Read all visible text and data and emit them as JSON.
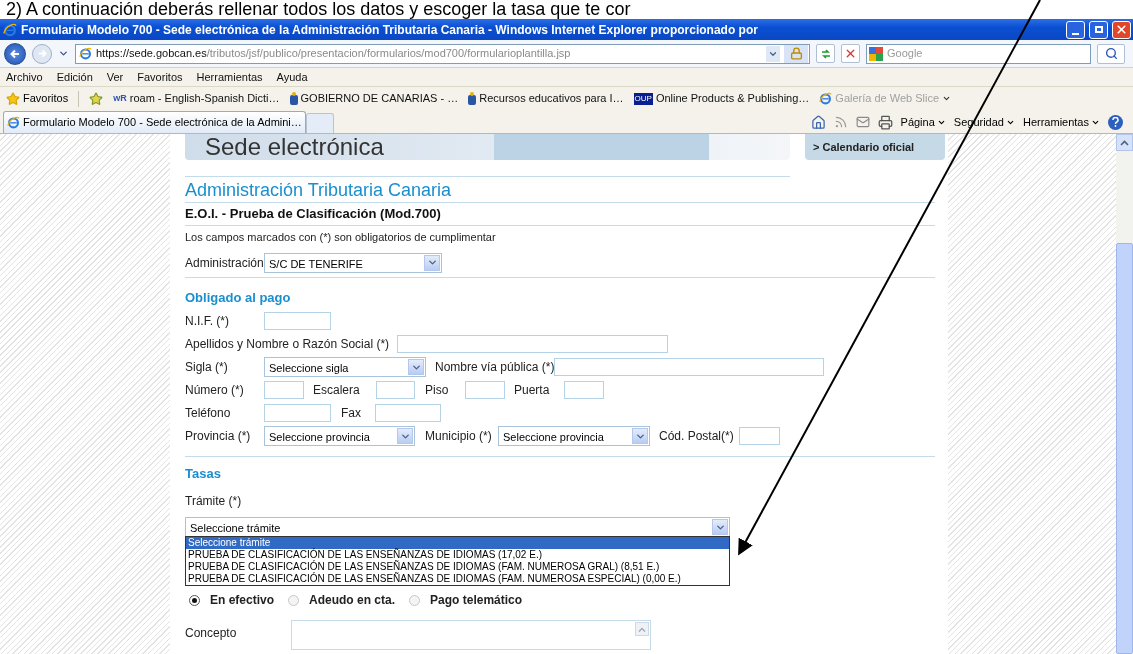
{
  "annotation": {
    "text": "2) A continuación deberás rellenar todos los datos y escoger la tasa que te cor"
  },
  "window": {
    "title": "Formulario Modelo 700 - Sede electrónica de la Administración Tributaria Canaria - Windows Internet Explorer proporcionado por"
  },
  "address_bar": {
    "url_host": "https://sede.gobcan.es",
    "url_path": "/tributos/jsf/publico/presentacion/formularios/mod700/formularioplantilla.jsp",
    "search_placeholder": "Google"
  },
  "menu": [
    "Archivo",
    "Edición",
    "Ver",
    "Favoritos",
    "Herramientas",
    "Ayuda"
  ],
  "favorites_bar": {
    "label": "Favoritos",
    "links": [
      {
        "kind": "wr",
        "icon_text": "wR",
        "text": "roam - English-Spanish Dicti…",
        "disabled": false
      },
      {
        "kind": "gov",
        "text": "GOBIERNO DE CANARIAS - …",
        "disabled": false
      },
      {
        "kind": "gov",
        "text": "Recursos educativos para I…",
        "disabled": false
      },
      {
        "kind": "oup",
        "icon_text": "OUP",
        "text": "Online Products & Publishing…",
        "disabled": false
      },
      {
        "kind": "ie",
        "text": "Galería de Web Slice",
        "disabled": true
      }
    ]
  },
  "tabs": [
    {
      "label": "Formulario Modelo 700 - Sede electrónica de la Admini…",
      "selected": true
    }
  ],
  "command_bar": [
    "Página",
    "Seguridad",
    "Herramientas"
  ],
  "page": {
    "banner": {
      "heading": "Sede electrónica",
      "side_link": "> Calendario oficial"
    },
    "org_title": "Administración Tributaria Canaria",
    "form_title": "E.O.I. - Prueba de Clasificación (Mod.700)",
    "note": "Los campos marcados con (*) son obligatorios de cumplimentar",
    "administracion": {
      "label": "Administración",
      "value": "S/C DE TENERIFE"
    },
    "obligado": {
      "title": "Obligado al pago",
      "fields": [
        {
          "label": "N.I.F. (*)",
          "kind": "input"
        },
        {
          "label": "Apellidos y Nombre o Razón Social (*)",
          "kind": "input"
        },
        {
          "label": "Sigla (*)",
          "kind": "select",
          "value": "Seleccione sigla"
        },
        {
          "label": "Nombre vía pública (*)",
          "kind": "input"
        },
        {
          "label": "Número (*)",
          "kind": "input"
        },
        {
          "label": "Escalera",
          "kind": "input"
        },
        {
          "label": "Piso",
          "kind": "input"
        },
        {
          "label": "Puerta",
          "kind": "input"
        },
        {
          "label": "Teléfono",
          "kind": "input"
        },
        {
          "label": "Fax",
          "kind": "input"
        },
        {
          "label": "Provincia (*)",
          "kind": "select",
          "value": "Seleccione provincia"
        },
        {
          "label": "Municipio (*)",
          "kind": "select",
          "value": "Seleccione provincia"
        },
        {
          "label": "Cód. Postal(*)",
          "kind": "input"
        }
      ]
    },
    "tasas": {
      "title": "Tasas",
      "tramite_label": "Trámite (*)",
      "tramite_value": "Seleccione trámite",
      "expanded": true,
      "options": [
        {
          "label": "Seleccione trámite",
          "selected": true
        },
        {
          "label": "PRUEBA DE CLASIFICACIÓN DE LAS ENSEÑANZAS DE IDIOMAS (17,02 E.)",
          "selected": false
        },
        {
          "label": "PRUEBA DE CLASIFICACIÓN DE LAS ENSEÑANZAS DE IDIOMAS (FAM. NUMEROSA GRAL) (8,51 E.)",
          "selected": false
        },
        {
          "label": "PRUEBA DE CLASIFICACIÓN DE LAS ENSEÑANZAS DE IDIOMAS (FAM. NUMEROSA ESPECIAL) (0,00 E.)",
          "selected": false
        }
      ],
      "payment": [
        {
          "label": "En efectivo",
          "selected": true
        },
        {
          "label": "Adeudo en cta.",
          "selected": false
        },
        {
          "label": "Pago telemático",
          "selected": false
        }
      ],
      "concepto_label": "Concepto"
    }
  }
}
